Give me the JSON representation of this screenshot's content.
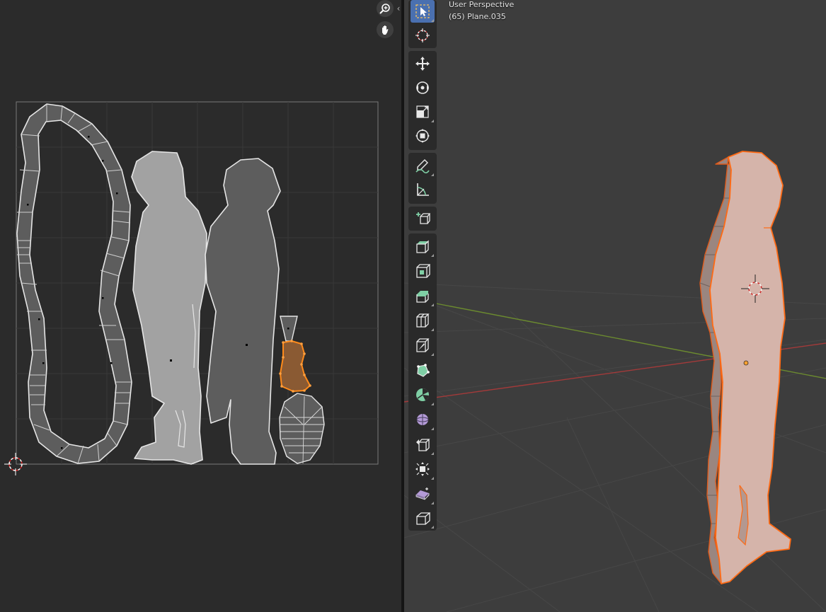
{
  "viewport": {
    "overlay_line1": "User Perspective",
    "overlay_line2": "(65) Plane.035"
  },
  "uv_editor": {
    "nav_icons": [
      "zoom-icon",
      "pan-hand-icon"
    ],
    "collapse_glyph": "‹"
  },
  "toolbar": {
    "tools": [
      "select-box-icon",
      "cursor-icon",
      "move-icon",
      "rotate-icon",
      "scale-icon",
      "transform-icon",
      "annotate-icon",
      "measure-icon",
      "add-cube-icon",
      "extrude-region-icon",
      "inset-faces-icon",
      "bevel-icon",
      "loop-cut-icon",
      "knife-icon",
      "poly-build-icon",
      "spin-icon",
      "smooth-icon",
      "edge-slide-icon",
      "shrink-fatten-icon",
      "shear-icon",
      "rip-region-icon"
    ]
  },
  "colors": {
    "selection": "#ff8a1a",
    "uv_island_light": "#a2a2a2",
    "uv_island_dark": "#5d5d5d",
    "model_face": "#d5b4aa",
    "tool_active": "#4a70b0",
    "tool_icon_green": "#7fcfa5",
    "tool_icon_purple": "#b39ad6"
  }
}
